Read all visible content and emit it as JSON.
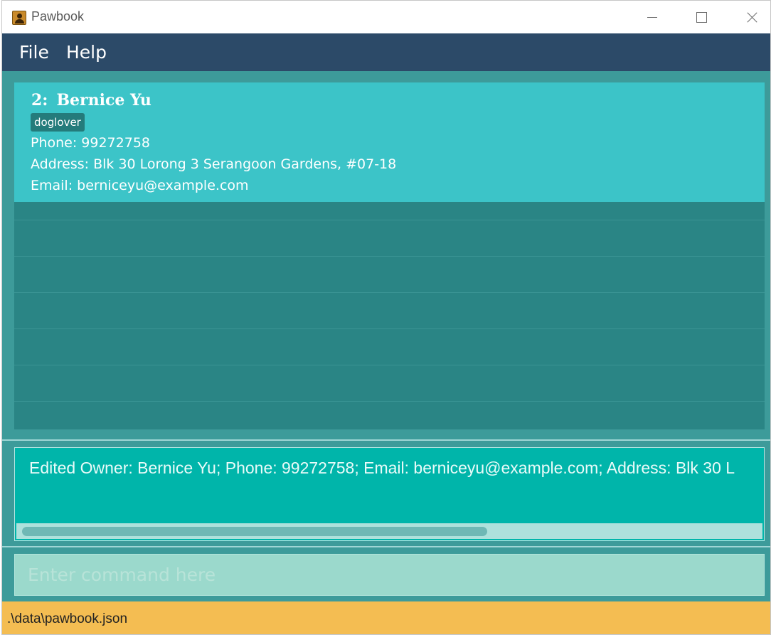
{
  "window": {
    "title": "Pawbook",
    "icon": "address-book-icon"
  },
  "menu": {
    "file_label": "File",
    "help_label": "Help"
  },
  "person_list": {
    "cards": [
      {
        "index": "2:",
        "name": "Bernice Yu",
        "tags": [
          "doglover"
        ],
        "phone": "Phone: 99272758",
        "address": "Address: Blk 30 Lorong 3 Serangoon Gardens, #07-18",
        "email": "Email: berniceyu@example.com"
      }
    ]
  },
  "result": {
    "text": "Edited Owner: Bernice Yu; Phone: 99272758; Email: berniceyu@example.com; Address: Blk 30 L"
  },
  "command": {
    "placeholder": "Enter command here",
    "value": ""
  },
  "status": {
    "file_path": ".\\data\\pawbook.json"
  },
  "colors": {
    "menubar": "#2c4a68",
    "background": "#3d9b9a",
    "card_selected": "#3cc4c8",
    "list_bg": "#2a8585",
    "tag_bg": "#247b7b",
    "result_bg": "#00b5aa",
    "command_bg": "#9bd9cc",
    "statusbar": "#f4bd52"
  }
}
